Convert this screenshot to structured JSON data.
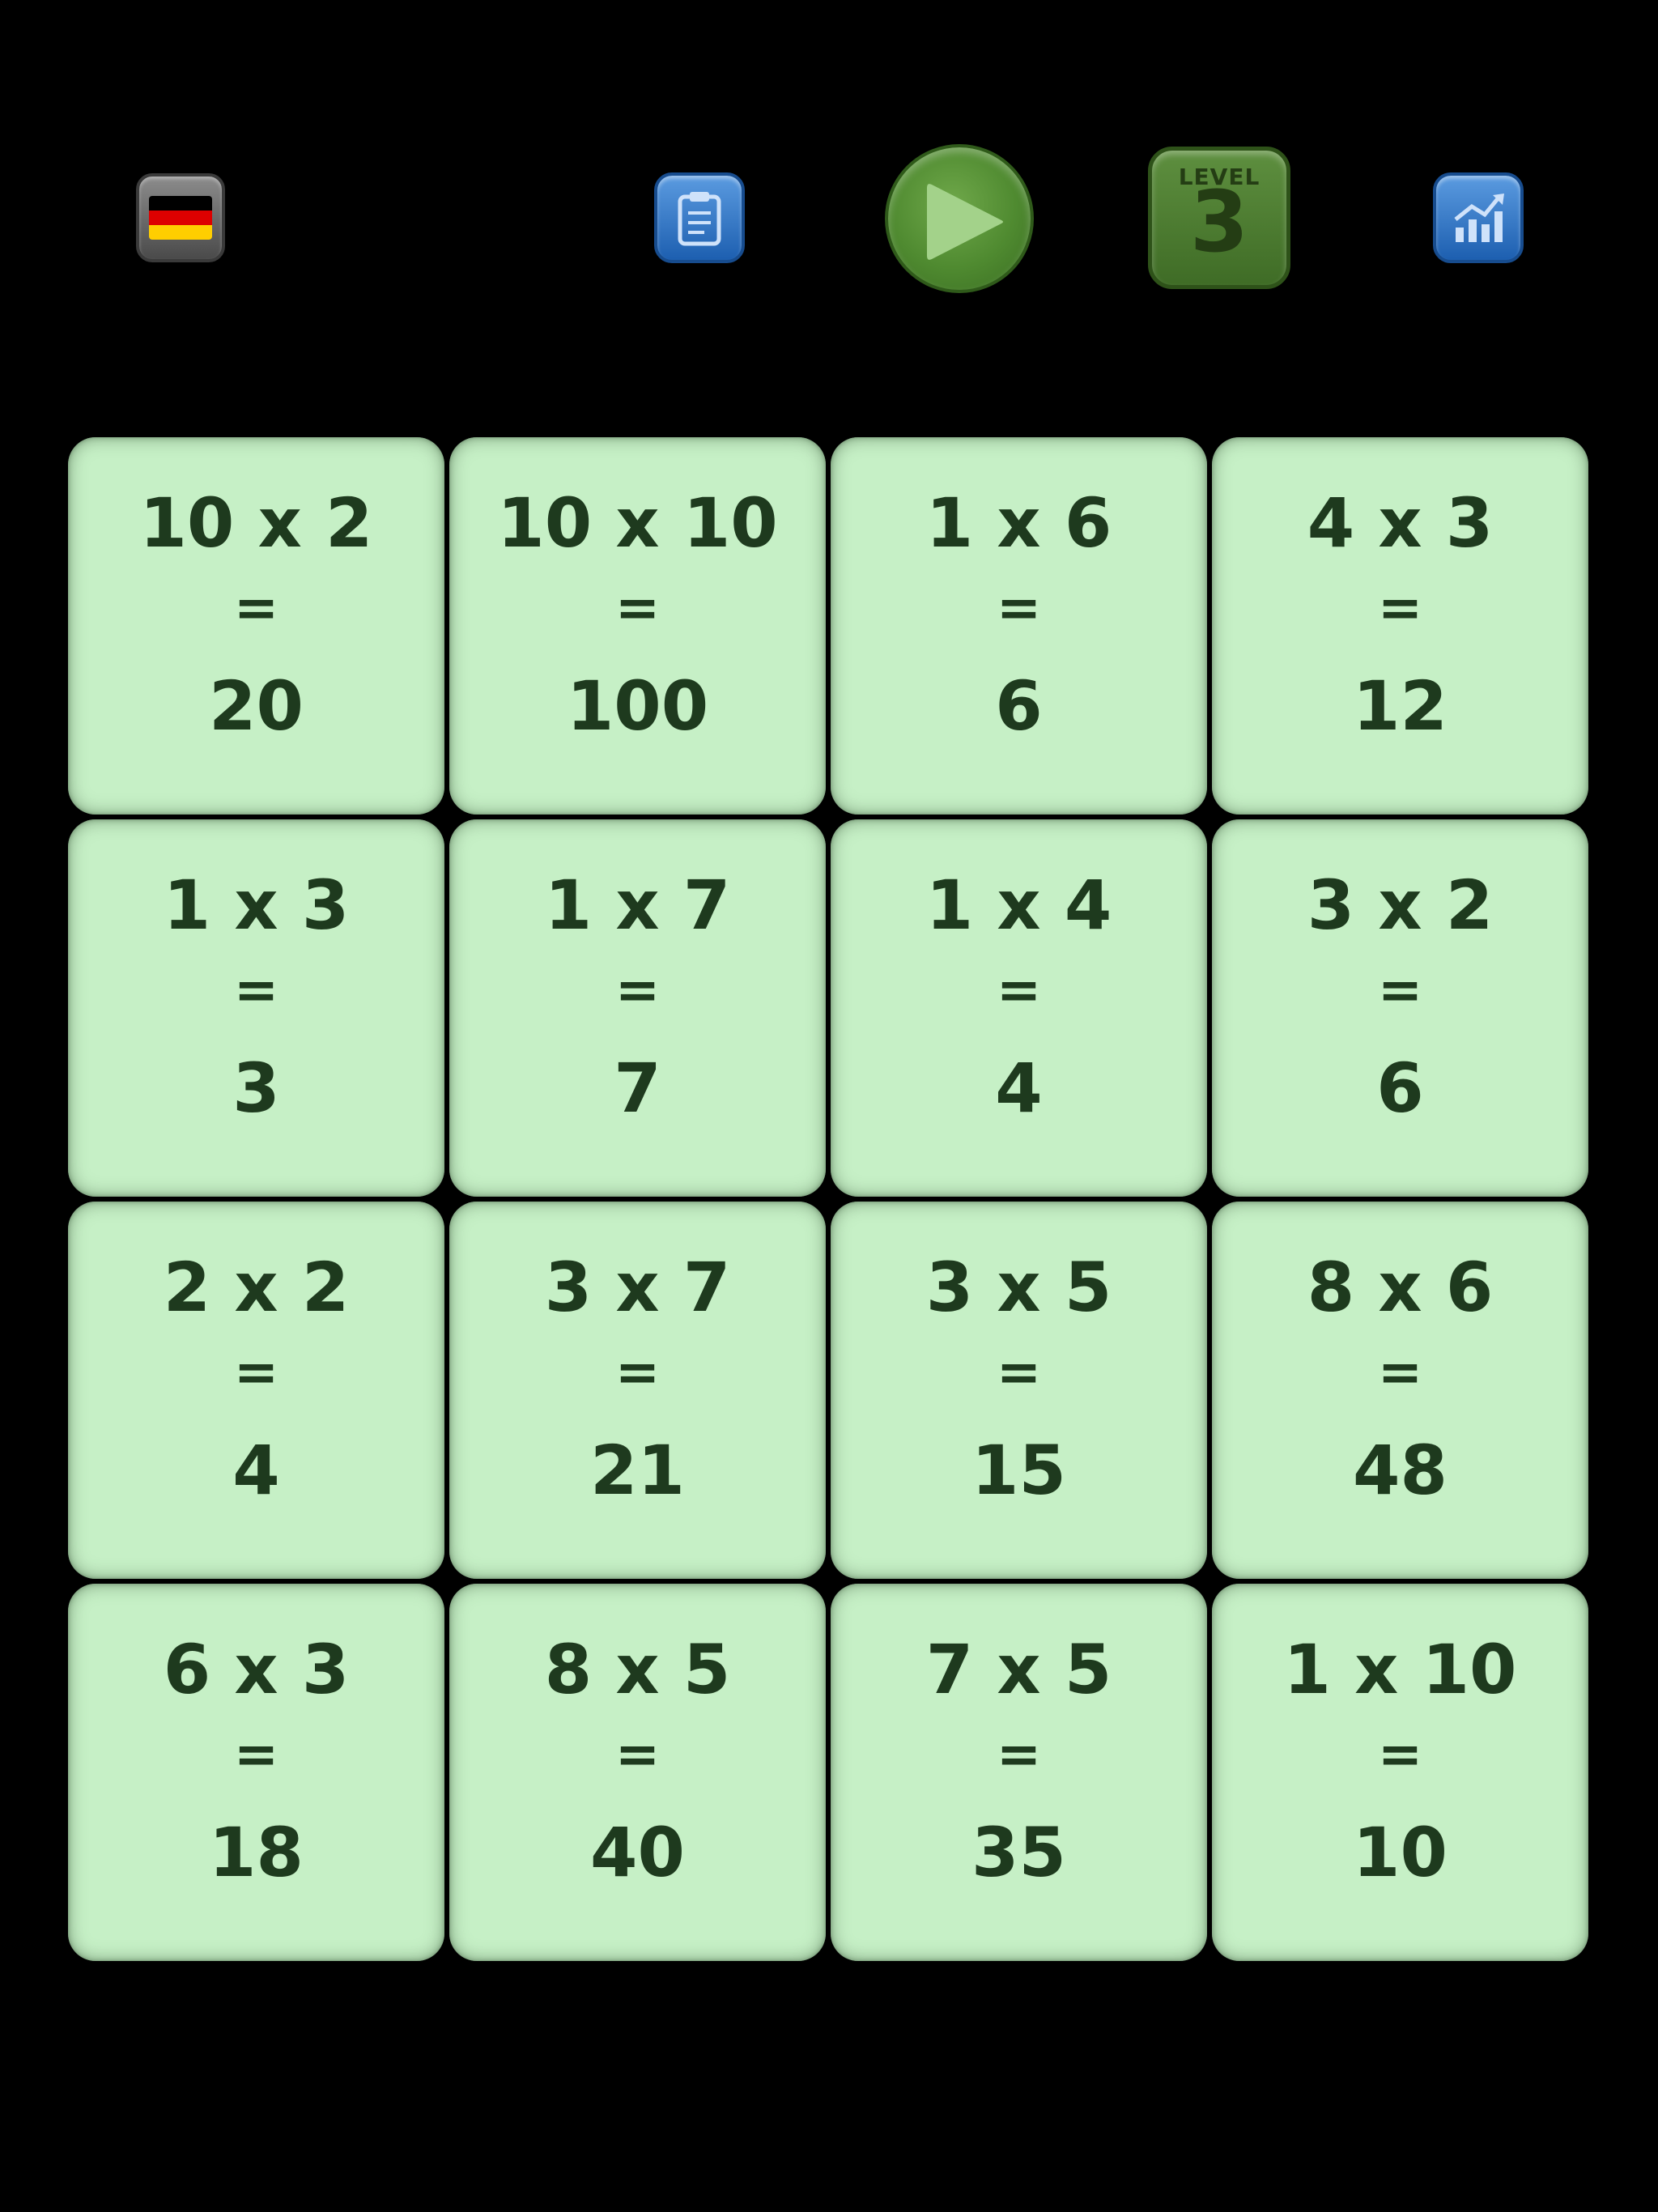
{
  "toolbar": {
    "language_flag": "germany-flag",
    "flag_colors": [
      "#000000",
      "#dd0000",
      "#ffce00"
    ],
    "clipboard_icon": "clipboard-icon",
    "play_icon": "play-icon",
    "stats_icon": "chart-icon",
    "level_label": "LEVEL",
    "level_number": "3"
  },
  "cards": [
    {
      "question": "10 x 2",
      "equals": "=",
      "answer": "20"
    },
    {
      "question": "10 x 10",
      "equals": "=",
      "answer": "100"
    },
    {
      "question": "1 x 6",
      "equals": "=",
      "answer": "6"
    },
    {
      "question": "4 x 3",
      "equals": "=",
      "answer": "12"
    },
    {
      "question": "1 x 3",
      "equals": "=",
      "answer": "3"
    },
    {
      "question": "1 x 7",
      "equals": "=",
      "answer": "7"
    },
    {
      "question": "1 x 4",
      "equals": "=",
      "answer": "4"
    },
    {
      "question": "3 x 2",
      "equals": "=",
      "answer": "6"
    },
    {
      "question": "2 x 2",
      "equals": "=",
      "answer": "4"
    },
    {
      "question": "3 x 7",
      "equals": "=",
      "answer": "21"
    },
    {
      "question": "3 x 5",
      "equals": "=",
      "answer": "15"
    },
    {
      "question": "8 x 6",
      "equals": "=",
      "answer": "48"
    },
    {
      "question": "6 x 3",
      "equals": "=",
      "answer": "18"
    },
    {
      "question": "8 x 5",
      "equals": "=",
      "answer": "40"
    },
    {
      "question": "7 x 5",
      "equals": "=",
      "answer": "35"
    },
    {
      "question": "1 x 10",
      "equals": "=",
      "answer": "10"
    }
  ]
}
